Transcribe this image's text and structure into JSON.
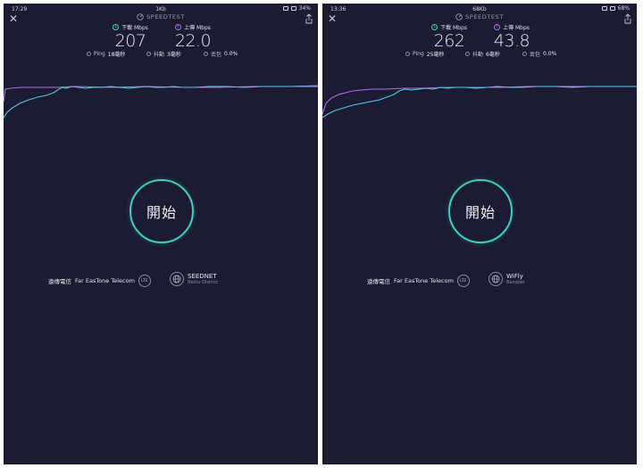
{
  "colors": {
    "background": "#1b1b31",
    "download": "#3dd9c1",
    "upload": "#b36bf0",
    "start_ring": "#3fcfbe"
  },
  "panels": [
    {
      "status": {
        "time": "17:29",
        "speed": "1Kb",
        "battery": "34%"
      },
      "brand": "SPEEDTEST",
      "download": {
        "label": "下載 Mbps",
        "value": "207"
      },
      "upload": {
        "label": "上傳 Mbps",
        "value": "22.0"
      },
      "stats": {
        "ping_label": "Ping",
        "ping_value": "18毫秒",
        "jitter_label": "抖動",
        "jitter_value": "3毫秒",
        "loss_label": "丟包",
        "loss_value": "0.0%"
      },
      "start_label": "開始",
      "carrier": {
        "label": "遠傳電信",
        "name": "Far EasTone Telecom",
        "badge": "LTE"
      },
      "server": {
        "name": "SEEDNET",
        "location": "Neihu District"
      }
    },
    {
      "status": {
        "time": "13:36",
        "speed": "68Kb",
        "battery": "68%"
      },
      "brand": "SPEEDTEST",
      "download": {
        "label": "下載 Mbps",
        "value": "262"
      },
      "upload": {
        "label": "上傳 Mbps",
        "value": "43.8"
      },
      "stats": {
        "ping_label": "Ping",
        "ping_value": "25毫秒",
        "jitter_label": "抖動",
        "jitter_value": "6毫秒",
        "loss_label": "丟包",
        "loss_value": "0.0%"
      },
      "start_label": "開始",
      "carrier": {
        "label": "遠傳電信",
        "name": "Far EasTone Telecom",
        "badge": "LTE"
      },
      "server": {
        "name": "WiFly",
        "location": "Banqiao"
      }
    }
  ]
}
